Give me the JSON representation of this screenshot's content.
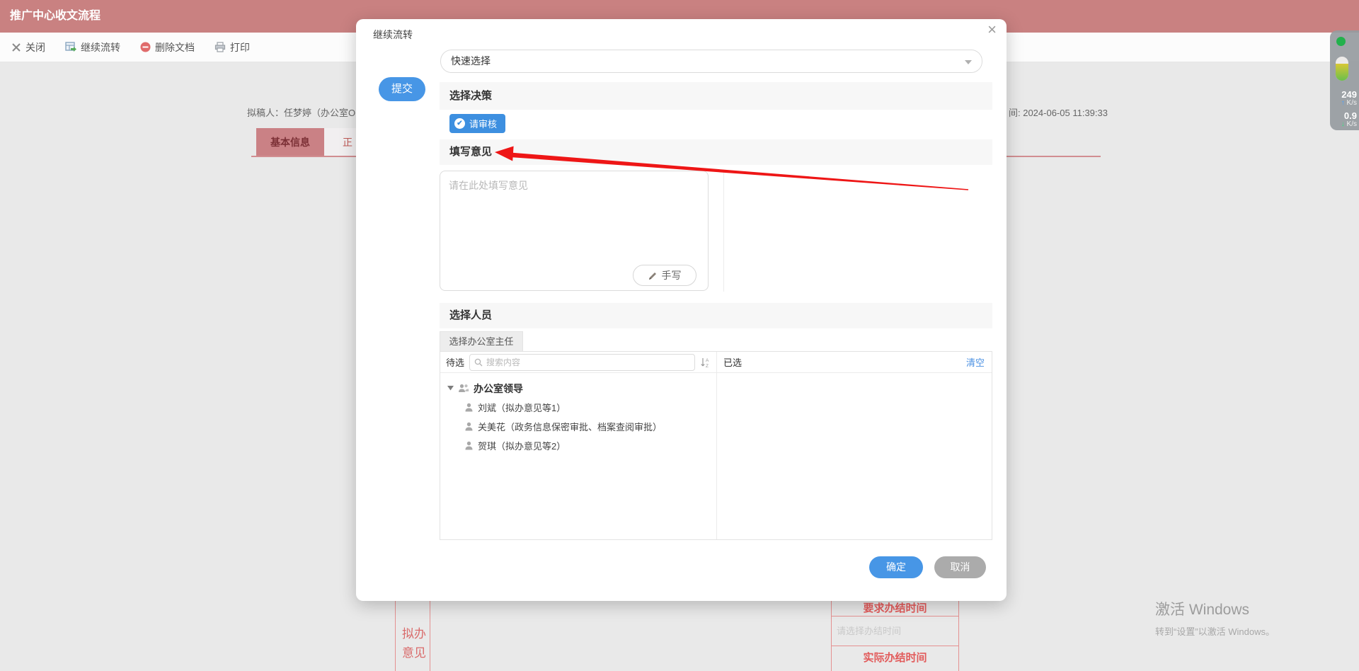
{
  "page": {
    "window_title": "推广中心收文流程",
    "toolbar": {
      "items": [
        {
          "icon": "close-icon",
          "label": "关闭"
        },
        {
          "icon": "continue-flow-icon",
          "label": "继续流转"
        },
        {
          "icon": "delete-doc-icon",
          "label": "删除文档"
        },
        {
          "icon": "print-icon",
          "label": "打印"
        }
      ]
    },
    "doc_info_left": "拟稿人：任梦婷（办公室O",
    "doc_info_right": "间: 2024-06-05 11:39:33",
    "tabs": [
      {
        "label": "基本信息",
        "active": true
      },
      {
        "label": "正",
        "active": false
      }
    ],
    "left_cell_lines": [
      "拟办",
      "意见"
    ],
    "right_table": {
      "row1": "要求办结时间",
      "row2_placeholder": "请选择办结时间",
      "row3": "实际办结时间"
    },
    "watermark": {
      "line1": "激活 Windows",
      "line2": "转到“设置”以激活 Windows。"
    }
  },
  "net_widget": {
    "up_value": "249",
    "up_unit": "K/s",
    "down_value": "0.9",
    "down_unit": "K/s"
  },
  "modal": {
    "title": "继续流转",
    "close_glyph": "×",
    "quick_select_value": "快速选择",
    "submit_label": "提交",
    "decision_header": "选择决策",
    "decision_chip": "请审核",
    "chip_check_glyph": "✔",
    "opinion_header": "填写意见",
    "opinion_placeholder": "请在此处填写意见",
    "handwrite_label": "手写",
    "person_header": "选择人员",
    "person_tab": "选择办公室主任",
    "pending_label": "待选",
    "search_placeholder": "搜索内容",
    "selected_label": "已选",
    "clear_label": "清空",
    "tree": {
      "group": "办公室领导",
      "members": [
        "刘斌（拟办意见等1）",
        "关美花（政务信息保密审批、档案查阅审批）",
        "贺琪（拟办意见等2）"
      ]
    },
    "confirm_label": "确定",
    "cancel_label": "取消"
  },
  "colors": {
    "titlebar": "#c98181",
    "accent_blue": "#4796e6",
    "chip_blue": "#3d8fe0",
    "link_blue": "#4a90e2",
    "table_red": "#e25b5b",
    "arrow_red": "#ee1616"
  }
}
